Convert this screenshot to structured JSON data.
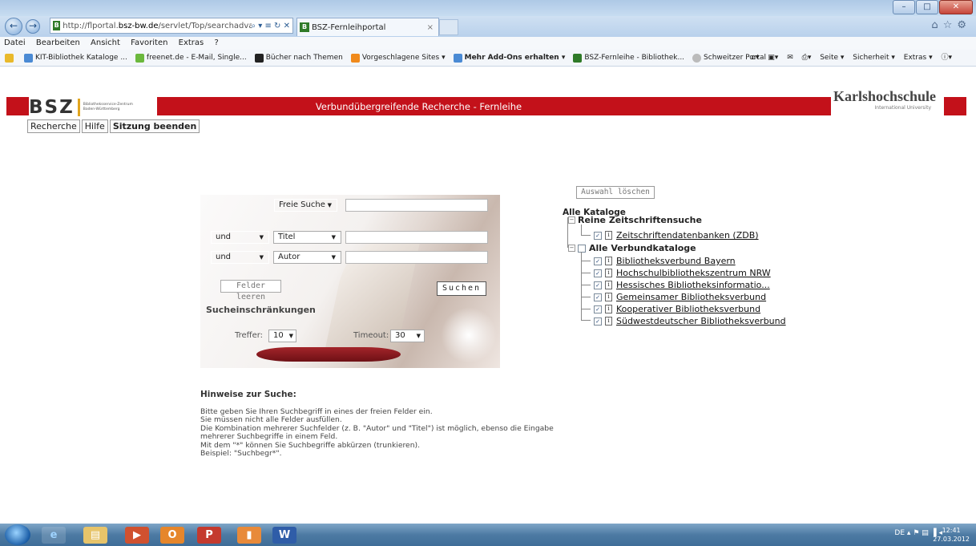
{
  "browser": {
    "url_prefix": "http://flportal.",
    "url_domain": "bsz-bw.de",
    "url_path": "/servlet/Top/searchadvanced;jsession",
    "url_tools": "⌕ ▾ ≡ ↻ ✕",
    "tab_title": "BSZ-Fernleihportal",
    "tab_close": "×",
    "menu": [
      "Datei",
      "Bearbeiten",
      "Ansicht",
      "Favoriten",
      "Extras",
      "?"
    ],
    "favorites": [
      "KIT-Bibliothek Kataloge ...",
      "freenet.de - E-Mail, Single...",
      "Bücher nach Themen",
      "Vorgeschlagene Sites ▾",
      "Mehr Add-Ons erhalten ▾",
      "BSZ-Fernleihe - Bibliothek...",
      "Schweitzer Portal"
    ],
    "commands": [
      "Seite ▾",
      "Sicherheit ▾",
      "Extras ▾"
    ],
    "colors": {
      "accent_red": "#c3111a"
    }
  },
  "header": {
    "logo_text": "BSZ",
    "logo_subtitle_1": "Bibliotheksservice-Zentrum",
    "logo_subtitle_2": "Baden-Württemberg",
    "title": "Verbundübergreifende Recherche - Fernleihe",
    "partner_name": "Karlshochschule",
    "partner_sub": "International University"
  },
  "nav": {
    "items": [
      "Recherche",
      "Hilfe",
      "Sitzung beenden"
    ]
  },
  "search": {
    "row1_field": "Freie Suche",
    "row2_op": "und",
    "row2_field": "Titel",
    "row3_op": "und",
    "row3_field": "Autor",
    "clear_label": "Felder leeren",
    "search_label": "Suchen",
    "restrictions_label": "Sucheinschränkungen",
    "hits_label": "Treffer:",
    "hits_value": "10",
    "timeout_label": "Timeout:",
    "timeout_value": "30"
  },
  "hints": {
    "title": "Hinweise zur Suche:",
    "lines": [
      "Bitte geben Sie Ihren Suchbegriff in eines der freien Felder ein.",
      "Sie müssen nicht alle Felder ausfüllen.",
      "Die Kombination mehrerer Suchfelder (z. B. \"Autor\" und \"Titel\") ist möglich, ebenso die Eingabe",
      "mehrerer Suchbegriffe in einem Feld.",
      "Mit dem \"*\" können Sie Suchbegriffe abkürzen (trunkieren).",
      "Beispiel: \"Suchbegr*\"."
    ]
  },
  "catalogs": {
    "clear_selection": "Auswahl löschen",
    "root": "Alle Kataloge",
    "group1": "Reine Zeitschriftensuche",
    "group1_items": [
      "Zeitschriftendatenbanken (ZDB)"
    ],
    "group2": "Alle Verbundkataloge",
    "group2_items": [
      "Bibliotheksverbund Bayern",
      "Hochschulbibliothekszentrum NRW",
      "Hessisches Bibliotheksinformatio...",
      "Gemeinsamer Bibliotheksverbund",
      "Kooperativer Bibliotheksverbund",
      "Südwestdeutscher Bibliotheksverbund"
    ]
  },
  "taskbar": {
    "lang": "DE",
    "time": "12:41",
    "date": "27.03.2012"
  }
}
